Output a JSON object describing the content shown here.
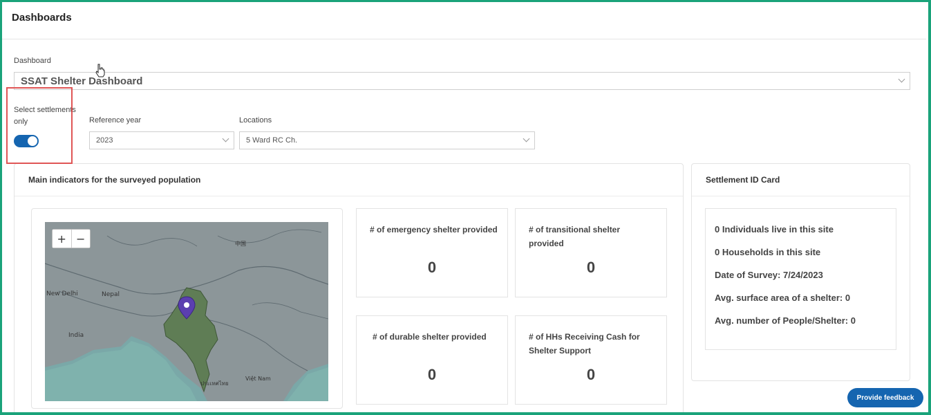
{
  "header": {
    "title": "Dashboards"
  },
  "dashboard_select": {
    "label": "Dashboard",
    "value": "SSAT Shelter Dashboard"
  },
  "settlements_toggle": {
    "label": "Select settlements only",
    "on": true
  },
  "reference_year": {
    "label": "Reference year",
    "value": "2023"
  },
  "locations": {
    "label": "Locations",
    "value": "5 Ward RC Ch."
  },
  "main_indicators": {
    "title": "Main indicators for the surveyed population",
    "map": {
      "zoom_in": "+",
      "zoom_out": "−",
      "labels": [
        "中国",
        "Nepal",
        "New Delhi",
        "India",
        "Việt Nam",
        "ประเทศไทย"
      ]
    },
    "indicators": [
      {
        "title": "# of emergency shelter provided",
        "value": "0"
      },
      {
        "title": "# of transitional shelter provided",
        "value": "0"
      },
      {
        "title": "# of durable shelter provided",
        "value": "0"
      },
      {
        "title": "# of HHs Receiving Cash for Shelter Support",
        "value": "0"
      }
    ]
  },
  "settlement_card": {
    "title": "Settlement ID Card",
    "lines": [
      "0 Individuals live in this site",
      "0 Households in this site",
      "Date of Survey: 7/24/2023",
      "Avg. surface area of a shelter: 0",
      "Avg. number of People/Shelter: 0"
    ]
  },
  "feedback_button": {
    "label": "Provide feedback"
  },
  "colors": {
    "accent": "#1565b0",
    "frame": "#1aa37a",
    "highlight": "#e05555"
  }
}
